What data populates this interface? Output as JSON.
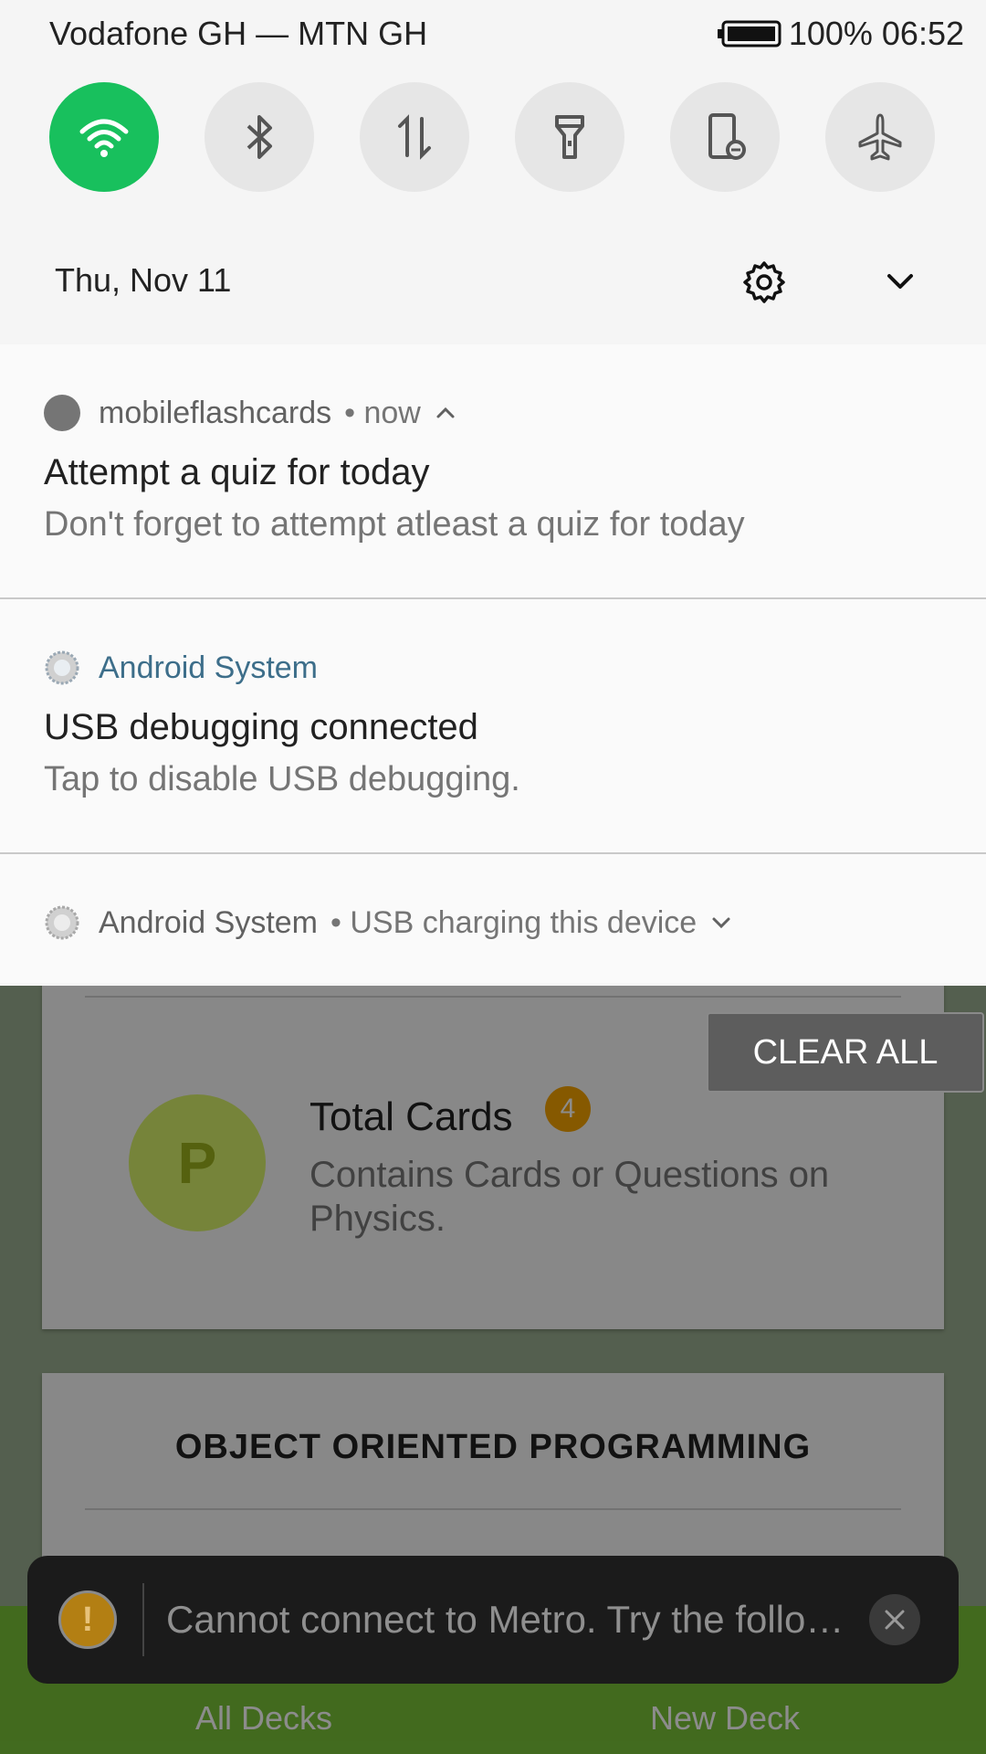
{
  "status_bar": {
    "carrier": "Vodafone GH — MTN GH",
    "battery": "100%",
    "time": "06:52"
  },
  "quick_settings": {
    "tiles": [
      "wifi-icon",
      "bluetooth-icon",
      "mobile-data-icon",
      "flashlight-icon",
      "screen-rotate-lock-icon",
      "airplane-icon"
    ],
    "active_color": "#18c05d"
  },
  "shade": {
    "date": "Thu, Nov 11"
  },
  "notifications": [
    {
      "app": "mobileflashcards",
      "meta": "• now",
      "title": "Attempt a quiz for today",
      "text": "Don't forget to attempt atleast a quiz for today"
    },
    {
      "app": "Android System",
      "title": "USB debugging connected",
      "text": "Tap to disable USB debugging."
    },
    {
      "app": "Android System",
      "meta": "• USB charging this device"
    }
  ],
  "clear_all_label": "CLEAR ALL",
  "background_app": {
    "deck1": {
      "avatar_letter": "P",
      "title": "Total Cards",
      "count": "4",
      "desc": "Contains Cards or Questions on Physics."
    },
    "deck2": {
      "title": "OBJECT ORIENTED PROGRAMMING"
    },
    "nav": {
      "all_decks": "All Decks",
      "new_deck": "New Deck"
    }
  },
  "toast": {
    "text": "Cannot connect to Metro.  Try the follo…",
    "icon": "warning-icon"
  }
}
